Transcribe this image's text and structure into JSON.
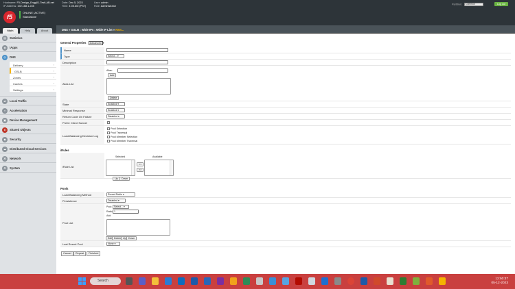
{
  "header": {
    "hostname_label": "Hostname:",
    "hostname": "F5-Design_Engg01-TestLAB.net",
    "ip_label": "IP Address:",
    "ip": "192.168.1.245",
    "date_label": "Date:",
    "date": "Dec 5, 2023",
    "time_label": "Time:",
    "time": "4:05 AM (PST)",
    "user_label": "User:",
    "user": "admin",
    "role_label": "Role:",
    "role": "Administrator",
    "status_online": "ONLINE (ACTIVE)",
    "status_mode": "Standalone",
    "partition_label": "Partition:",
    "partition_value": "Common",
    "logout": "Log out",
    "logo": "f5"
  },
  "tabs": [
    "Main",
    "Help",
    "About"
  ],
  "breadcrumb": {
    "path": "DNS  »  GSLB : Wide IPs : Wide IP List  »",
    "current": "New..."
  },
  "sidebar": {
    "items": [
      {
        "label": "Statistics",
        "icon": "statistics-icon"
      },
      {
        "label": "iApps",
        "icon": "iapps-icon"
      },
      {
        "label": "DNS",
        "icon": "dns-icon"
      }
    ],
    "dns_sub": [
      "Delivery",
      "GSLB",
      "Zones",
      "Caches",
      "Settings"
    ],
    "lower_items": [
      {
        "label": "Local Traffic",
        "icon": "local-traffic-icon"
      },
      {
        "label": "Acceleration",
        "icon": "acceleration-icon"
      },
      {
        "label": "Device Management",
        "icon": "device-management-icon"
      },
      {
        "label": "Shared Objects",
        "icon": "shared-objects-icon"
      },
      {
        "label": "Security",
        "icon": "security-icon"
      },
      {
        "label": "Distributed Cloud Services",
        "icon": "cloud-icon"
      },
      {
        "label": "Network",
        "icon": "network-icon"
      },
      {
        "label": "System",
        "icon": "system-icon"
      }
    ]
  },
  "general": {
    "title": "General Properties",
    "mode": "Advanced",
    "name_label": "Name",
    "type_label": "Type",
    "type_value": "Select...",
    "description_label": "Description",
    "alias_label": "Alias List",
    "alias_field_label": "Alias:",
    "add": "Add",
    "delete": "Delete",
    "state_label": "State",
    "state_value": "Enabled",
    "minimal_label": "Minimal Response",
    "minimal_value": "Enabled",
    "rcode_label": "Return Code On Failure",
    "rcode_value": "Disabled",
    "persubmit_label": "Prefer Client Subnet",
    "lb_log_label": "Load-Balancing Decision Log",
    "lb_log_options": [
      "Pool Selection",
      "Pool Traversal",
      "Pool Member Selection",
      "Pool Member Traversal"
    ]
  },
  "irules": {
    "title": "iRules",
    "list_label": "iRule List",
    "selected": "Selected",
    "available": "Available",
    "move_left": "<<",
    "move_right": ">>",
    "up": "Up",
    "down": "Down"
  },
  "pools": {
    "title": "Pools",
    "lb_method_label": "Load Balancing Method",
    "lb_method_value": "Round Robin",
    "persistence_label": "Persistence",
    "persistence_value": "Disabled",
    "pool_list_label": "Pool List",
    "pool_field": "Pool:",
    "pool_value": "Select...",
    "ratio_field": "Ratio:",
    "ratio_value": "1",
    "add": "Add",
    "edit": "Edit",
    "delete": "Delete",
    "up": "Up",
    "down": "Down",
    "last_resort_label": "Last Resort Pool",
    "last_resort_value": "None"
  },
  "footer": {
    "cancel": "Cancel",
    "repeat": "Repeat",
    "finished": "Finished"
  },
  "taskbar": {
    "search": "Search",
    "time": "12:50:37",
    "date": "05-12-2023"
  }
}
